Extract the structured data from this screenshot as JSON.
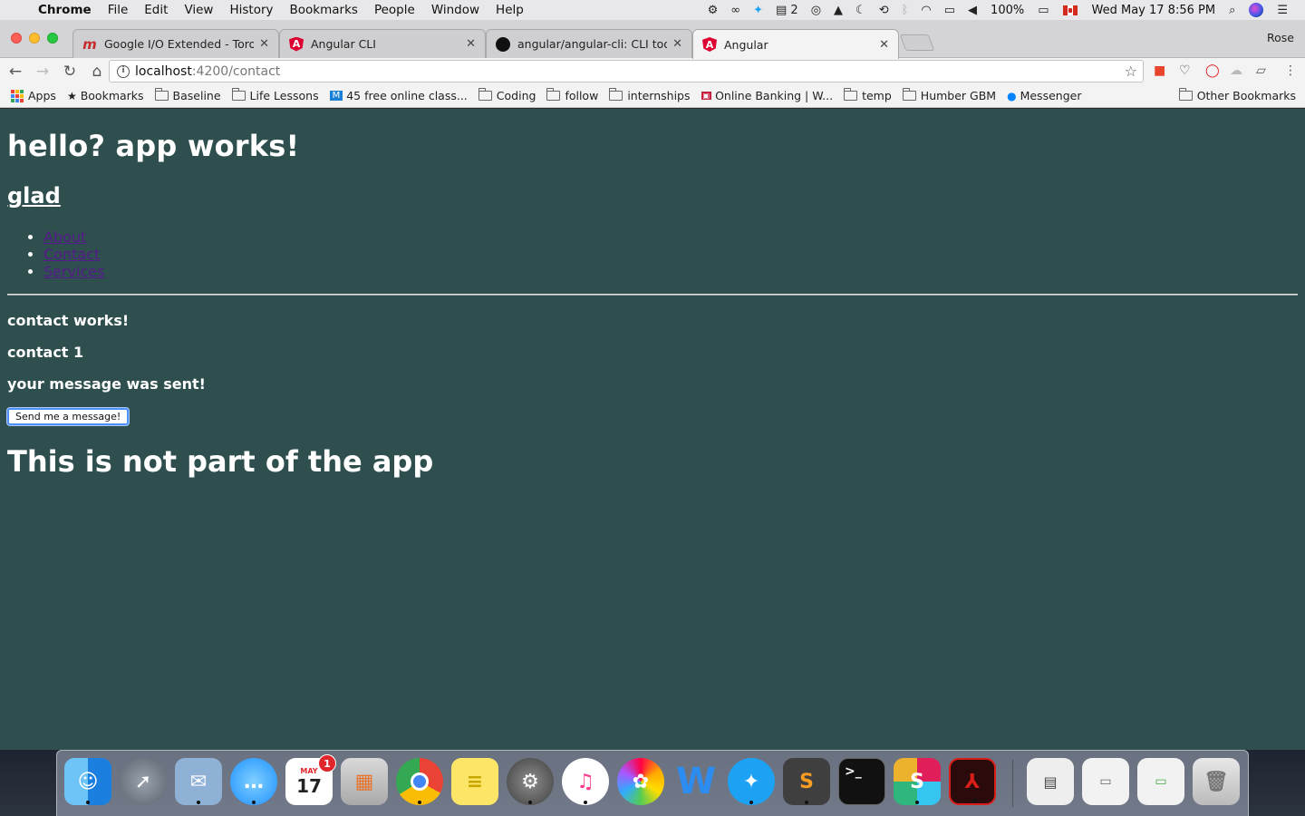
{
  "menubar": {
    "app_name": "Chrome",
    "items": [
      "File",
      "Edit",
      "View",
      "History",
      "Bookmarks",
      "People",
      "Window",
      "Help"
    ],
    "status_badge": "2",
    "battery": "100%",
    "datetime": "Wed May 17  8:56 PM"
  },
  "browser": {
    "profile_name": "Rose",
    "tabs": [
      {
        "title": "Google I/O Extended - Toronto",
        "icon": "google-io-icon"
      },
      {
        "title": "Angular CLI",
        "icon": "angular-icon"
      },
      {
        "title": "angular/angular-cli: CLI tool for",
        "icon": "github-icon"
      },
      {
        "title": "Angular",
        "icon": "angular-icon",
        "active": true
      }
    ],
    "url_host": "localhost",
    "url_path": ":4200/contact",
    "bookmarks": [
      "Apps",
      "Bookmarks",
      "Baseline",
      "Life Lessons",
      "45 free online class...",
      "Coding",
      "follow",
      "internships",
      "Online Banking | W...",
      "temp",
      "Humber GBM",
      "Messenger"
    ],
    "other_bookmarks": "Other Bookmarks"
  },
  "page": {
    "title": "hello? app works!",
    "subtitle_link": "glad",
    "nav_links": [
      "About",
      "Contact",
      "Services"
    ],
    "contact_status": "contact works!",
    "contact_label": "contact 1",
    "message_status": "your message was sent!",
    "send_button": "Send me a message!",
    "footer_heading": "This is not part of the app"
  },
  "dock": {
    "calendar_month": "MAY",
    "calendar_day": "17",
    "calendar_badge": "1"
  },
  "colors": {
    "page_background": "#2f4f4f",
    "link_color": "#551a8b",
    "focus_ring": "#4d90fe"
  }
}
